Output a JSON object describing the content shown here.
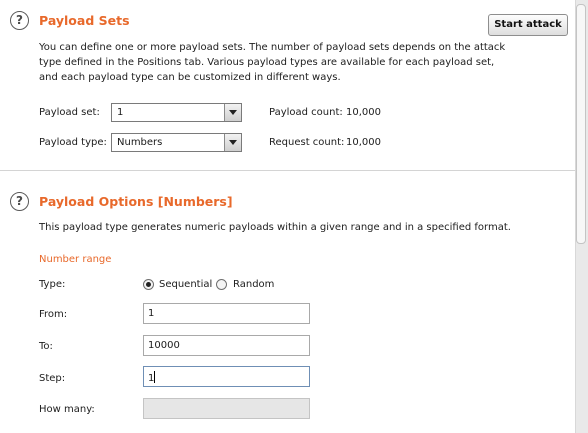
{
  "payload_sets": {
    "title": "Payload Sets",
    "description_lines": [
      "You can define one or more payload sets. The number of payload sets depends on the attack",
      "type defined in the Positions tab. Various payload types are available for each payload set,",
      "and each payload type can be customized in different ways."
    ],
    "start_attack_label": "Start attack",
    "set_label": "Payload set:",
    "set_value": "1",
    "type_label": "Payload type:",
    "type_value": "Numbers",
    "payload_count_label": "Payload count:",
    "payload_count_value": "10,000",
    "request_count_label": "Request count:",
    "request_count_value": "10,000"
  },
  "payload_options": {
    "title": "Payload Options [Numbers]",
    "description": "This payload type generates numeric payloads within a given range and in a specified format.",
    "number_range_label": "Number range",
    "type_label": "Type:",
    "sequential_label": "Sequential",
    "random_label": "Random",
    "selected_type": "Sequential",
    "from_label": "From:",
    "from_value": "1",
    "to_label": "To:",
    "to_value": "10000",
    "step_label": "Step:",
    "step_value": "1",
    "how_many_label": "How many:",
    "how_many_value": ""
  },
  "icons": {
    "help": "?"
  },
  "colors": {
    "accent": "#e8692b"
  }
}
